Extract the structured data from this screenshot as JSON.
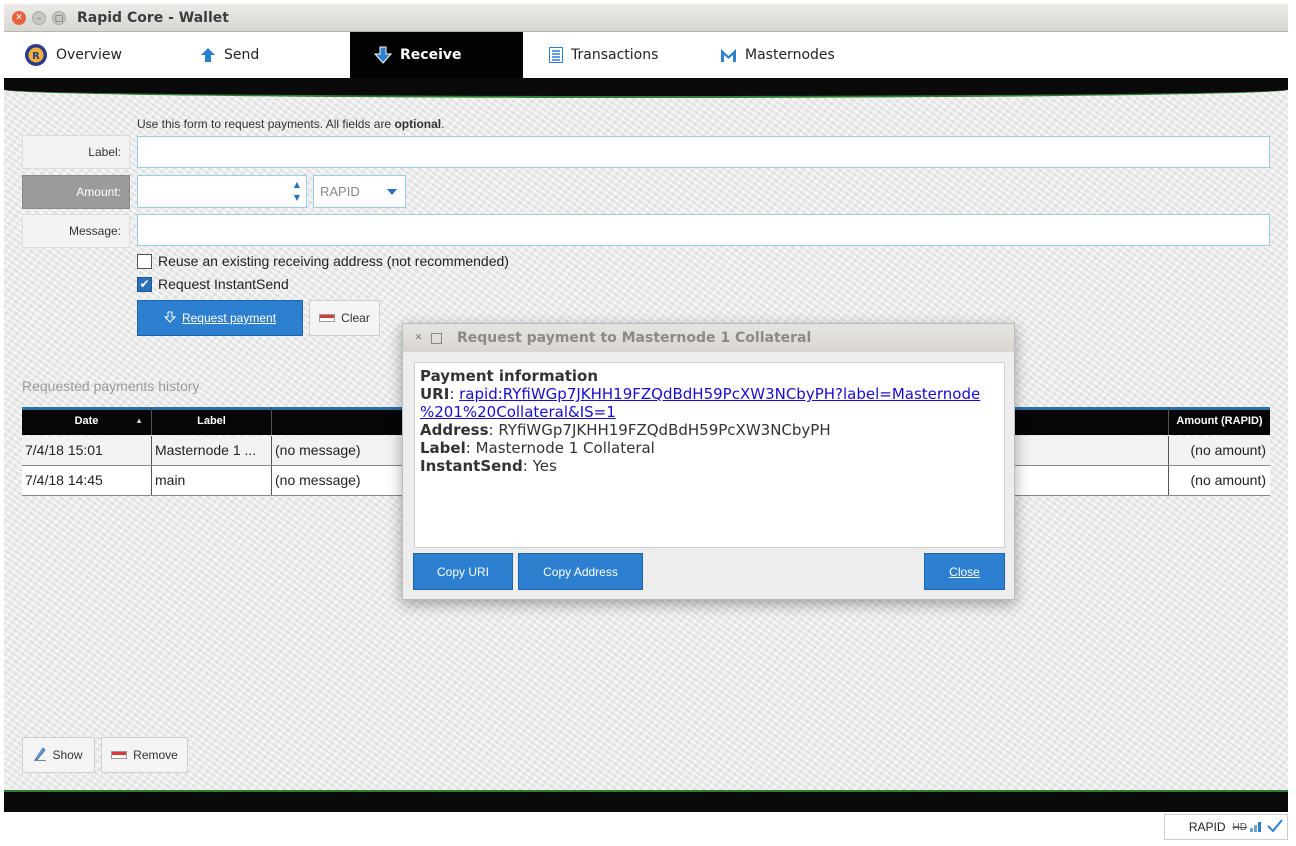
{
  "window": {
    "title": "Rapid Core - Wallet",
    "close_glyph": "✕",
    "min_glyph": "–",
    "max_glyph": "□"
  },
  "tabs": [
    {
      "label": "Overview",
      "icon": "rapid-logo-icon"
    },
    {
      "label": "Send",
      "icon": "arrow-up-icon"
    },
    {
      "label": "Receive",
      "icon": "arrow-down-icon",
      "active": true
    },
    {
      "label": "Transactions",
      "icon": "list-icon"
    },
    {
      "label": "Masternodes",
      "icon": "masternode-icon"
    }
  ],
  "form": {
    "hint_prefix": "Use this form to request payments. All fields are ",
    "hint_bold": "optional",
    "hint_suffix": ".",
    "label_label": "Label:",
    "label_value": "",
    "amount_label": "Amount:",
    "amount_value": "",
    "unit": "RAPID",
    "message_label": "Message:",
    "message_value": "",
    "reuse_label": "Reuse an existing receiving address (not recommended)",
    "reuse_checked": false,
    "instantsend_label": "Request InstantSend",
    "instantsend_checked": true,
    "check_glyph": "✔",
    "request_button": "Request payment",
    "clear_button": "Clear"
  },
  "history": {
    "title": "Requested payments history",
    "columns": [
      "Date",
      "Label",
      "",
      "Amount (RAPID)"
    ],
    "rows": [
      {
        "date": "7/4/18 15:01",
        "label": "Masternode 1 ...",
        "message": "(no message)",
        "amount": "(no amount)"
      },
      {
        "date": "7/4/18 14:45",
        "label": "main",
        "message": "(no message)",
        "amount": "(no amount)"
      }
    ],
    "show_button": "Show",
    "remove_button": "Remove"
  },
  "dialog": {
    "title": "Request payment to Masternode 1 Collateral",
    "close_glyph": "✕",
    "max_glyph": "□",
    "heading": "Payment information",
    "uri_label": "URI",
    "uri_line1": "rapid:RYfiWGp7JKHH19FZQdBdH59PcXW3NCbyPH?label=Masternode",
    "uri_line2": "%201%20Collateral&IS=1",
    "address_label": "Address",
    "address_value": "RYfiWGp7JKHH19FZQdBdH59PcXW3NCbyPH",
    "label_label": "Label",
    "label_value": "Masternode 1 Collateral",
    "instantsend_label": "InstantSend",
    "instantsend_value": "Yes",
    "copy_uri_button": "Copy URI",
    "copy_address_button": "Copy Address",
    "close_button": "Close"
  },
  "status": {
    "unit": "RAPID",
    "hd_label": "HD"
  },
  "colors": {
    "accent": "#2d7fcf",
    "active_tab": "#020202",
    "band_green": "#2e7d32"
  }
}
